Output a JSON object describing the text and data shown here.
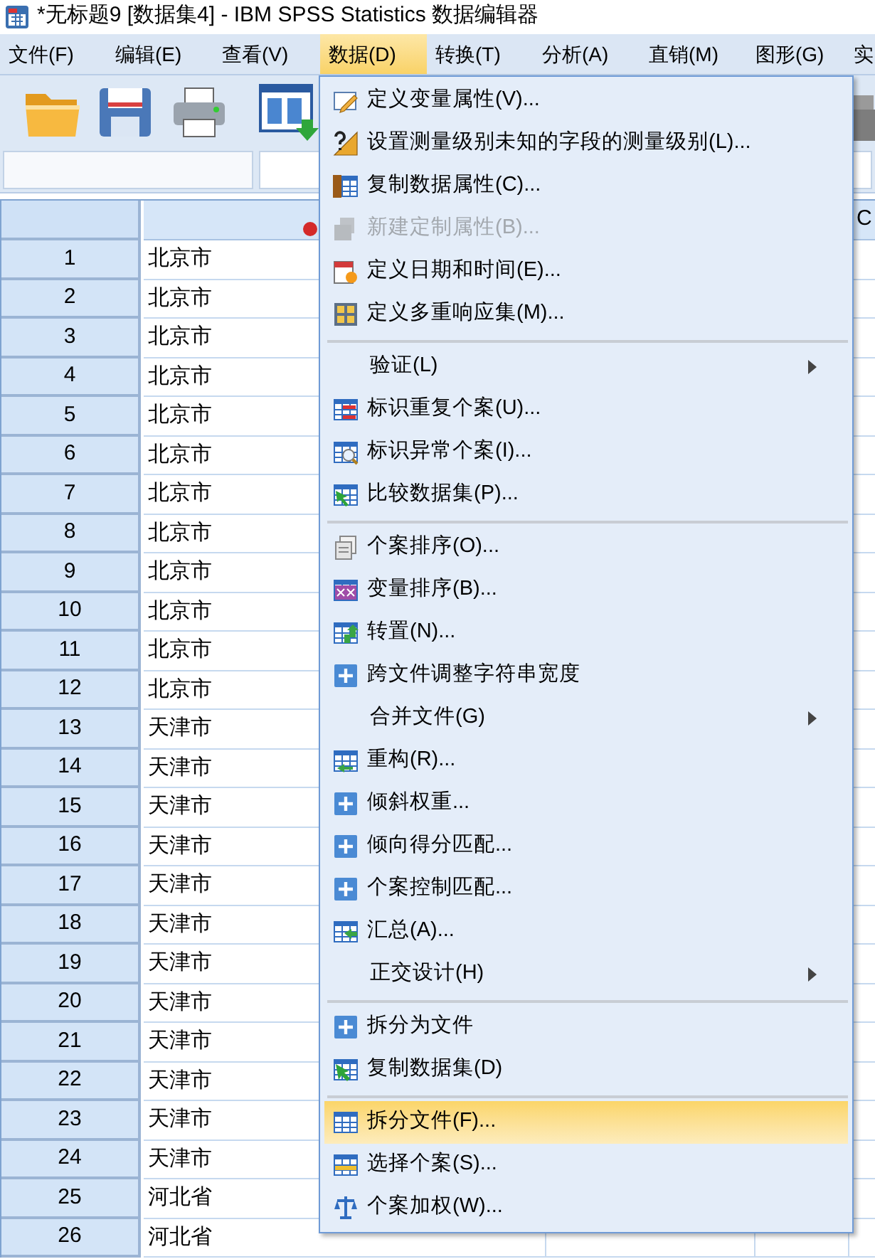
{
  "window": {
    "title": "*无标题9 [数据集4] - IBM SPSS Statistics 数据编辑器"
  },
  "menu_bar": [
    {
      "label": "文件(F)",
      "selected": false
    },
    {
      "label": "编辑(E)",
      "selected": false
    },
    {
      "label": "查看(V)",
      "selected": false
    },
    {
      "label": "数据(D)",
      "selected": true
    },
    {
      "label": "转换(T)",
      "selected": false
    },
    {
      "label": "分析(A)",
      "selected": false
    },
    {
      "label": "直销(M)",
      "selected": false
    },
    {
      "label": "图形(G)",
      "selected": false
    },
    {
      "label": "实",
      "selected": false
    }
  ],
  "grid": {
    "column_4_header": "C",
    "rows": [
      {
        "number": "1",
        "column_1": "北京市"
      },
      {
        "number": "2",
        "column_1": "北京市"
      },
      {
        "number": "3",
        "column_1": "北京市"
      },
      {
        "number": "4",
        "column_1": "北京市"
      },
      {
        "number": "5",
        "column_1": "北京市"
      },
      {
        "number": "6",
        "column_1": "北京市"
      },
      {
        "number": "7",
        "column_1": "北京市"
      },
      {
        "number": "8",
        "column_1": "北京市"
      },
      {
        "number": "9",
        "column_1": "北京市"
      },
      {
        "number": "10",
        "column_1": "北京市"
      },
      {
        "number": "11",
        "column_1": "北京市"
      },
      {
        "number": "12",
        "column_1": "北京市"
      },
      {
        "number": "13",
        "column_1": "天津市"
      },
      {
        "number": "14",
        "column_1": "天津市"
      },
      {
        "number": "15",
        "column_1": "天津市"
      },
      {
        "number": "16",
        "column_1": "天津市"
      },
      {
        "number": "17",
        "column_1": "天津市"
      },
      {
        "number": "18",
        "column_1": "天津市"
      },
      {
        "number": "19",
        "column_1": "天津市"
      },
      {
        "number": "20",
        "column_1": "天津市"
      },
      {
        "number": "21",
        "column_1": "天津市"
      },
      {
        "number": "22",
        "column_1": "天津市"
      },
      {
        "number": "23",
        "column_1": "天津市"
      },
      {
        "number": "24",
        "column_1": "天津市"
      },
      {
        "number": "25",
        "column_1": "河北省"
      },
      {
        "number": "26",
        "column_1": "河北省"
      }
    ]
  },
  "data_menu": [
    {
      "kind": "command",
      "label": "定义变量属性(V)...",
      "disabled": false,
      "selected": false
    },
    {
      "kind": "command",
      "label": "设置测量级别未知的字段的测量级别(L)...",
      "disabled": false,
      "selected": false
    },
    {
      "kind": "command",
      "label": "复制数据属性(C)...",
      "disabled": false,
      "selected": false
    },
    {
      "kind": "command",
      "label": "新建定制属性(B)...",
      "disabled": true,
      "selected": false
    },
    {
      "kind": "command",
      "label": "定义日期和时间(E)...",
      "disabled": false,
      "selected": false
    },
    {
      "kind": "command",
      "label": "定义多重响应集(M)...",
      "disabled": false,
      "selected": false
    },
    {
      "kind": "separator"
    },
    {
      "kind": "submenu",
      "label": "验证(L)",
      "disabled": false,
      "selected": false
    },
    {
      "kind": "command",
      "label": "标识重复个案(U)...",
      "disabled": false,
      "selected": false
    },
    {
      "kind": "command",
      "label": "标识异常个案(I)...",
      "disabled": false,
      "selected": false
    },
    {
      "kind": "command",
      "label": "比较数据集(P)...",
      "disabled": false,
      "selected": false
    },
    {
      "kind": "separator"
    },
    {
      "kind": "command",
      "label": "个案排序(O)...",
      "disabled": false,
      "selected": false
    },
    {
      "kind": "command",
      "label": "变量排序(B)...",
      "disabled": false,
      "selected": false
    },
    {
      "kind": "command",
      "label": "转置(N)...",
      "disabled": false,
      "selected": false
    },
    {
      "kind": "command",
      "label": "跨文件调整字符串宽度",
      "disabled": false,
      "selected": false
    },
    {
      "kind": "submenu",
      "label": "合并文件(G)",
      "disabled": false,
      "selected": false
    },
    {
      "kind": "command",
      "label": "重构(R)...",
      "disabled": false,
      "selected": false
    },
    {
      "kind": "command",
      "label": "倾斜权重...",
      "disabled": false,
      "selected": false
    },
    {
      "kind": "command",
      "label": "倾向得分匹配...",
      "disabled": false,
      "selected": false
    },
    {
      "kind": "command",
      "label": "个案控制匹配...",
      "disabled": false,
      "selected": false
    },
    {
      "kind": "command",
      "label": "汇总(A)...",
      "disabled": false,
      "selected": false
    },
    {
      "kind": "submenu",
      "label": "正交设计(H)",
      "disabled": false,
      "selected": false
    },
    {
      "kind": "separator"
    },
    {
      "kind": "command",
      "label": "拆分为文件",
      "disabled": false,
      "selected": false
    },
    {
      "kind": "command",
      "label": "复制数据集(D)",
      "disabled": false,
      "selected": false
    },
    {
      "kind": "separator"
    },
    {
      "kind": "command",
      "label": "拆分文件(F)...",
      "disabled": false,
      "selected": true
    },
    {
      "kind": "command",
      "label": "选择个案(S)...",
      "disabled": false,
      "selected": false
    },
    {
      "kind": "command",
      "label": "个案加权(W)...",
      "disabled": false,
      "selected": false
    }
  ]
}
